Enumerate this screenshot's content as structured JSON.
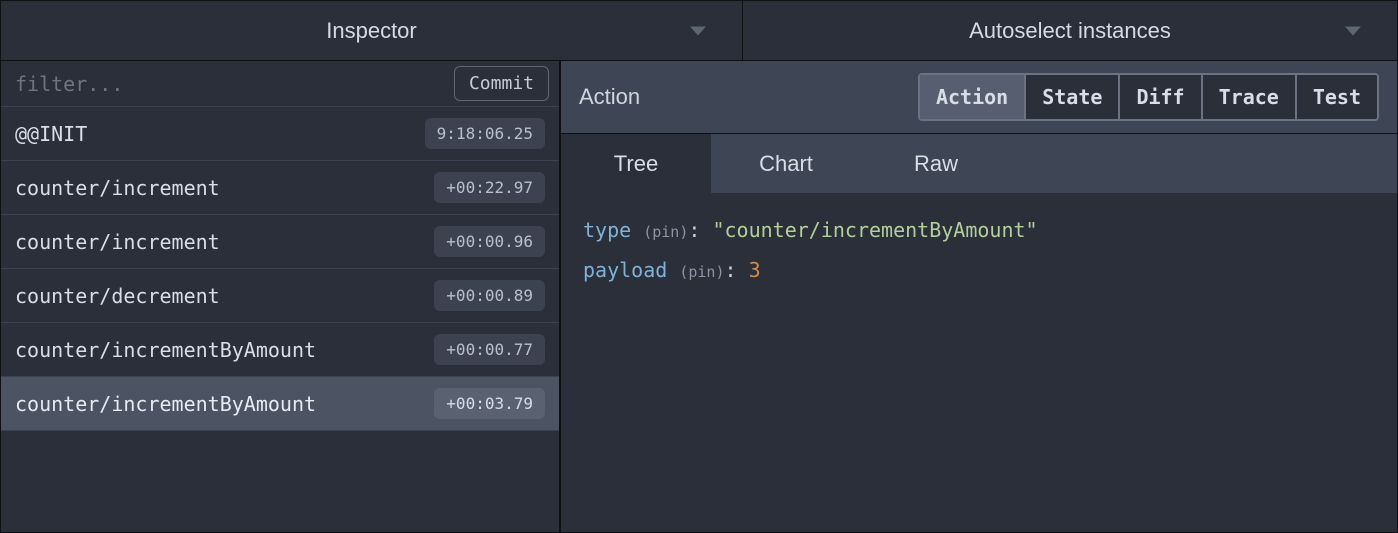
{
  "header": {
    "inspector_label": "Inspector",
    "instances_label": "Autoselect instances"
  },
  "filter": {
    "placeholder": "filter...",
    "commit_label": "Commit"
  },
  "log": [
    {
      "name": "@@INIT",
      "ts": "9:18:06.25",
      "selected": false
    },
    {
      "name": "counter/increment",
      "ts": "+00:22.97",
      "selected": false
    },
    {
      "name": "counter/increment",
      "ts": "+00:00.96",
      "selected": false
    },
    {
      "name": "counter/decrement",
      "ts": "+00:00.89",
      "selected": false
    },
    {
      "name": "counter/incrementByAmount",
      "ts": "+00:00.77",
      "selected": false
    },
    {
      "name": "counter/incrementByAmount",
      "ts": "+00:03.79",
      "selected": true
    }
  ],
  "mode": {
    "title": "Action",
    "segments": [
      "Action",
      "State",
      "Diff",
      "Trace",
      "Test"
    ],
    "active_segment": "Action"
  },
  "view_tabs": {
    "items": [
      "Tree",
      "Chart",
      "Raw"
    ],
    "active": "Tree"
  },
  "tree": {
    "pin_label": "(pin)",
    "rows": [
      {
        "key": "type",
        "kind": "string",
        "value": "\"counter/incrementByAmount\""
      },
      {
        "key": "payload",
        "kind": "number",
        "value": "3"
      }
    ]
  }
}
